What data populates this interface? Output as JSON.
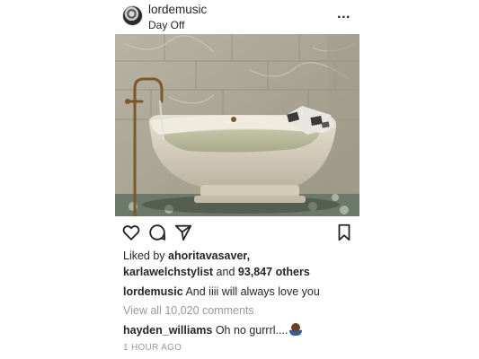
{
  "post": {
    "username": "lordemusic",
    "location": "Day Off",
    "more_icon": "more-horizontal-icon",
    "more_label": "...",
    "photo_subject": "marble-bathtub-photo"
  },
  "actions": {
    "like_icon": "heart-icon",
    "comment_icon": "comment-bubble-icon",
    "share_icon": "paper-plane-icon",
    "save_icon": "bookmark-icon"
  },
  "likes": {
    "prefix": "Liked by ",
    "user1": "ahoritavasaver,",
    "user2": "karlawelchstylist",
    "conjunction": " and ",
    "others": "93,847 others"
  },
  "caption": {
    "username": "lordemusic",
    "text": " And iiii will always love you"
  },
  "comments": {
    "view_all": "View all 10,020 comments",
    "items": [
      {
        "username": "hayden_williams",
        "text": " Oh no gurrrl....",
        "emoji": "person-emoji"
      }
    ]
  },
  "timestamp": "1 HOUR AGO"
}
